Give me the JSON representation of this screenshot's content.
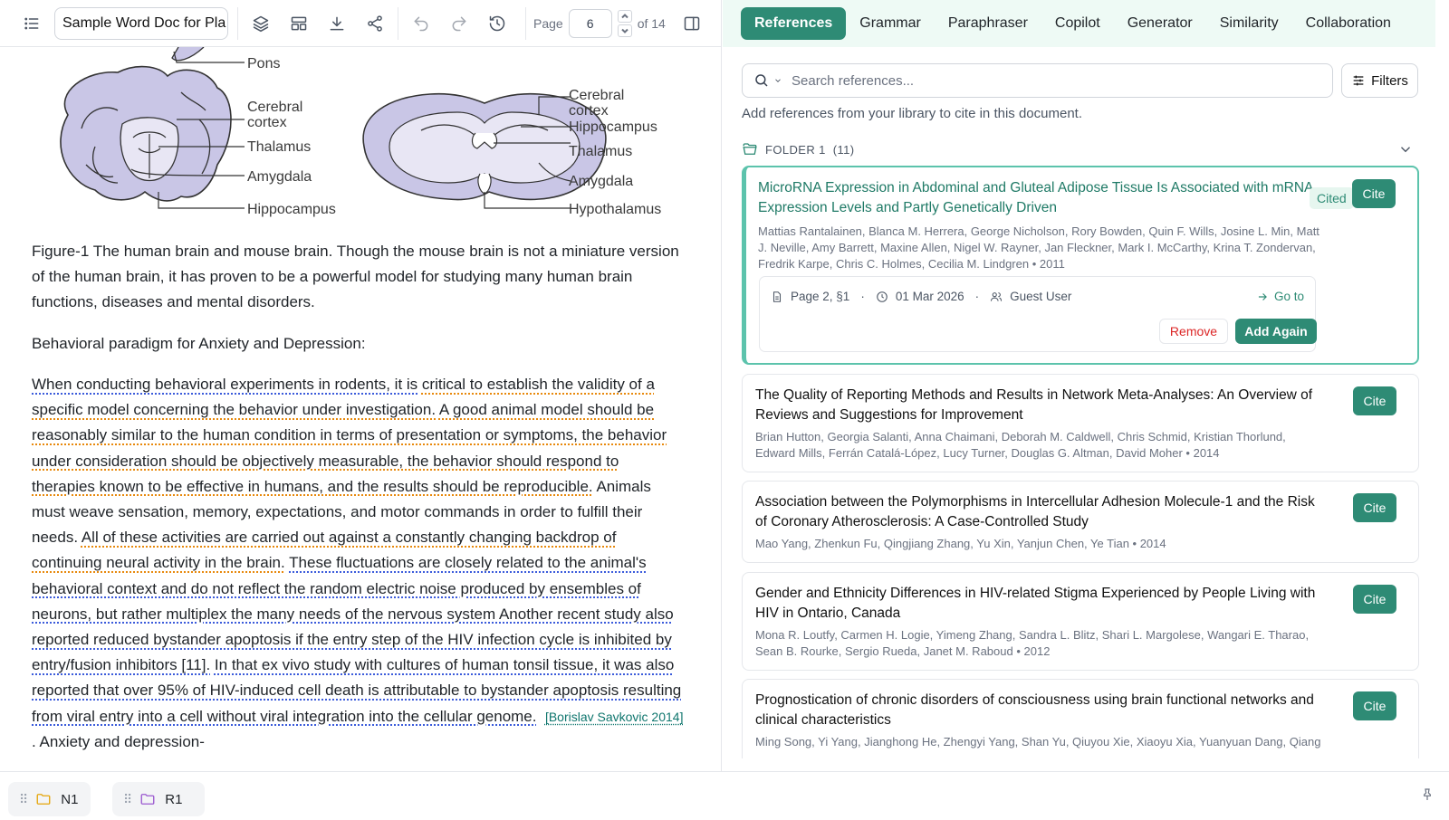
{
  "toolbar": {
    "doc_name": "Sample Word Doc for Pla",
    "page_label": "Page",
    "page_value": "6",
    "of_label": "of 14"
  },
  "figure": {
    "labels_human": [
      "Pons",
      "Cerebral",
      "cortex",
      "Thalamus",
      "Amygdala",
      "Hippocampus"
    ],
    "labels_mouse": [
      "Cerebral",
      "cortex",
      "Hippocampus",
      "Thalamus",
      "Amygdala",
      "Hypothalamus"
    ],
    "fill_color": "#c9c6e6",
    "stroke_color": "#333333"
  },
  "doc": {
    "caption": "Figure-1 The human brain and mouse brain. Though the mouse brain is not a miniature version of the human brain, it has proven to be a powerful model for studying many human brain functions, diseases and mental disorders.",
    "heading": "Behavioral paradigm for Anxiety and Depression:",
    "s1": "When conducting behavioral experiments in rodents, it is",
    "s2": "critical to establish the validity of a specific model concerning the behavior under investigation.",
    "s3": "A good animal model should be reasonably similar to the human condition in terms of presentation or symptoms, the behavior under consideration should be objectively measurable, the behavior should respond to therapies known to be effective in humans, and the results should be reproducible.",
    "s4": "Animals must weave sensation, memory, expectations, and motor commands in order to fulfill their needs.",
    "s5": "All of these activities are carried out against a constantly changing backdrop of continuing neural activity in the brain.",
    "s6": "These fluctuations are closely related to the animal's behavioral context and do not reflect the random electric noise produced by ensembles of neurons, but rather multiplex the many needs of the nervous system Another recent study also reported reduced bystander apoptosis if the entry step of the HIV infection cycle is inhibited by entry/fusion inhibitors [11].",
    "s7": "In that ex vivo study with cultures of human tonsil tissue, it was also reported that over 95% of HIV-induced cell death is attributable to bystander apoptosis resulting from viral entry into a cell without viral integration into the cellular genome.",
    "citation": "[Borislav Savkovic 2014]",
    "s8": ". Anxiety and depression-"
  },
  "tabs": [
    "References",
    "Grammar",
    "Paraphraser",
    "Copilot",
    "Generator",
    "Similarity",
    "Collaboration"
  ],
  "search": {
    "placeholder": "Search references..."
  },
  "filters_label": "Filters",
  "hint": "Add references from your library to cite in this document.",
  "folder": {
    "name": "FOLDER 1",
    "count": "(11)"
  },
  "cards": [
    {
      "title": "MicroRNA Expression in Abdominal and Gluteal Adipose Tissue Is Associated with mRNA Expression Levels and Partly Genetically Driven",
      "authors": "Mattias Rantalainen, Blanca M. Herrera, George Nicholson, Rory Bowden, Quin F. Wills, Josine L. Min, Matt J. Neville, Amy Barrett, Maxine Allen, Nigel W. Rayner, Jan Fleckner, Mark I. McCarthy, Krina T. Zondervan, Fredrik Karpe, Chris C. Holmes, Cecilia M. Lindgren • 2011",
      "badge": "Cited",
      "cite": "Cite",
      "location": "Page 2, §1",
      "date": "01 Mar 2026",
      "user": "Guest User",
      "goto": "Go to",
      "remove": "Remove",
      "add_again": "Add Again"
    },
    {
      "title": "The Quality of Reporting Methods and Results in Network Meta-Analyses: An Overview of Reviews and Suggestions for Improvement",
      "authors": "Brian Hutton, Georgia Salanti, Anna Chaimani, Deborah M. Caldwell, Chris Schmid, Kristian Thorlund, Edward Mills, Ferrán Catalá-López, Lucy Turner, Douglas G. Altman, David Moher • 2014",
      "cite": "Cite"
    },
    {
      "title": "Association between the Polymorphisms in Intercellular Adhesion Molecule-1 and the Risk of Coronary Atherosclerosis: A Case-Controlled Study",
      "authors": "Mao Yang, Zhenkun Fu, Qingjiang Zhang, Yu Xin, Yanjun Chen, Ye Tian • 2014",
      "cite": "Cite"
    },
    {
      "title": "Gender and Ethnicity Differences in HIV-related Stigma Experienced by People Living with HIV in Ontario, Canada",
      "authors": "Mona R. Loutfy, Carmen H. Logie, Yimeng Zhang, Sandra L. Blitz, Shari L. Margolese, Wangari E. Tharao, Sean B. Rourke, Sergio Rueda, Janet M. Raboud • 2012",
      "cite": "Cite"
    },
    {
      "title": "Prognostication of chronic disorders of consciousness using brain functional networks and clinical characteristics",
      "authors": "Ming Song, Yi Yang, Jianghong He, Zhengyi Yang, Shan Yu, Qiuyou Xie, Xiaoyu Xia, Yuanyuan Dang, Qiang",
      "cite": "Cite"
    }
  ],
  "bottom_tabs": [
    "N1",
    "R1"
  ],
  "colors": {
    "accent": "#2e8b75",
    "accent_light": "#5cc3ac",
    "tab_bg": "#eefaf5",
    "folder_n1": "#e5a50a",
    "folder_r1": "#9b59d0"
  }
}
